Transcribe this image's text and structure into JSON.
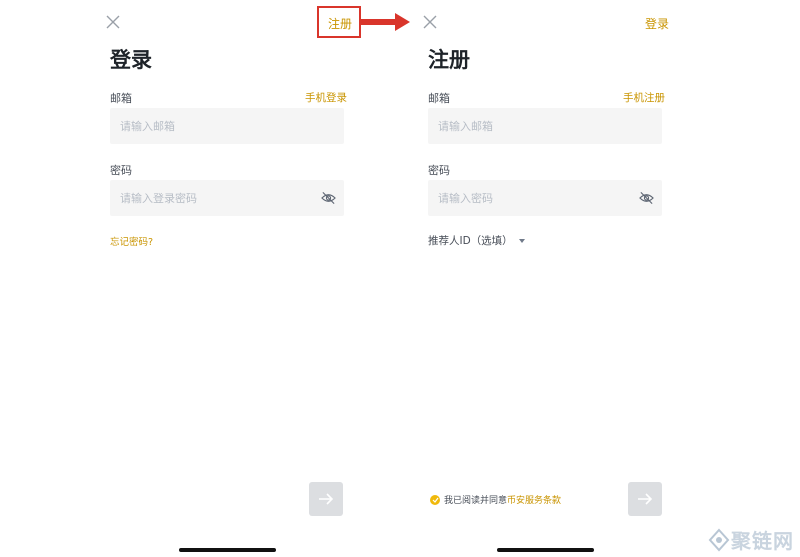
{
  "login": {
    "topbar_link": "注册",
    "title": "登录",
    "email_label": "邮箱",
    "alt_link": "手机登录",
    "email_placeholder": "请输入邮箱",
    "password_label": "密码",
    "password_placeholder": "请输入登录密码",
    "forgot_link": "忘记密码?"
  },
  "register": {
    "topbar_link": "登录",
    "title": "注册",
    "email_label": "邮箱",
    "alt_link": "手机注册",
    "email_placeholder": "请输入邮箱",
    "password_label": "密码",
    "password_placeholder": "请输入密码",
    "referral_label": "推荐人ID（选填）",
    "agree_text": "我已阅读并同意",
    "agree_link": "币安服务条款"
  },
  "watermark": {
    "text": "聚链网"
  },
  "icons": {
    "close": "close-icon",
    "eye_off": "eye-off-icon",
    "arrow_right": "arrow-right-icon",
    "caret_down": "caret-down-icon",
    "check": "check-circle-icon",
    "annotation_arrow": "red-arrow-icon"
  },
  "colors": {
    "accent": "#c99400",
    "annotation": "#d9352b",
    "input_bg": "#f5f5f5",
    "button_disabled": "#dcdee1"
  }
}
